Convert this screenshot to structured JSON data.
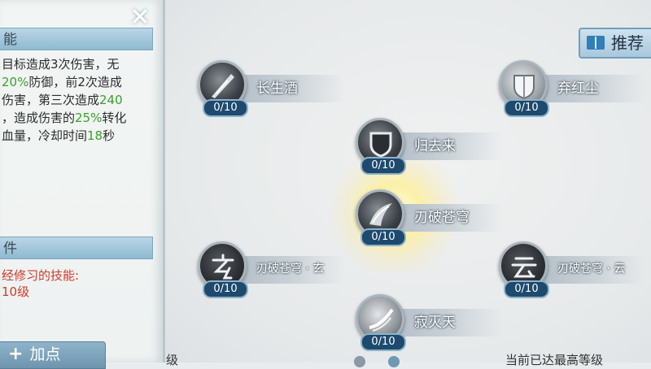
{
  "left_panel": {
    "desc_header": "能",
    "desc_lines": [
      [
        {
          "t": "目标造成3次伤害，无"
        }
      ],
      [
        {
          "t": "20%",
          "c": "g"
        },
        {
          "t": "防御，前2次造成"
        }
      ],
      [
        {
          "t": "伤害，第三次造成"
        },
        {
          "t": "240",
          "c": "g"
        }
      ],
      [
        {
          "t": "，造成伤害的"
        },
        {
          "t": "25%",
          "c": "g"
        },
        {
          "t": "转化"
        }
      ],
      [
        {
          "t": "血量，冷却时间"
        },
        {
          "t": "18",
          "c": "g"
        },
        {
          "t": "秒"
        }
      ]
    ],
    "req_header": "件",
    "req_label": "经修习的技能:",
    "req_level": "10级",
    "add_point_label": "加点"
  },
  "recommend_label": "推荐",
  "nodes": [
    {
      "id": "changshengjiu",
      "name": "长生酒",
      "level": "0/10",
      "icon": "sword-slash-icon"
    },
    {
      "id": "qihongchen",
      "name": "弃红尘",
      "level": "0/10",
      "icon": "shield-icon"
    },
    {
      "id": "guiqulai",
      "name": "归去来",
      "level": "0/10",
      "icon": "dark-shield-icon"
    },
    {
      "id": "renpocangqiong",
      "name": "刃破苍穹",
      "level": "0/10",
      "icon": "blade-wing-icon"
    },
    {
      "id": "renpocangqiong_xuan",
      "name": "刃破苍穹 · 玄",
      "level": "0/10",
      "icon": "xuan-glyph-icon"
    },
    {
      "id": "renpocangqiong_yun",
      "name": "刃破苍穹 · 云",
      "level": "0/10",
      "icon": "yun-glyph-icon"
    },
    {
      "id": "jimietian",
      "name": "寂灭天",
      "level": "0/10",
      "icon": "wind-slash-icon"
    }
  ],
  "bottom_left_text": "级",
  "bottom_right_text": "当前已达最高等级"
}
